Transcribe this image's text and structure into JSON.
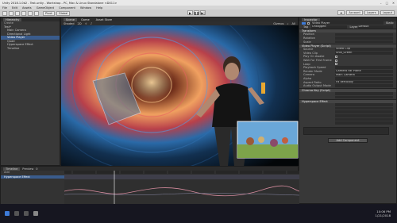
{
  "window": {
    "title": "Unity 2018.1.0b2 - Test.unity - Workshop - PC, Mac & Linux Standalone <DX11>"
  },
  "menu": [
    "File",
    "Edit",
    "Assets",
    "GameObject",
    "Component",
    "Window",
    "Help"
  ],
  "toolbar": {
    "pivot": "Pivot",
    "global": "Global",
    "account": "Account",
    "layers": "Layers",
    "layout": "Layout"
  },
  "hierarchy": {
    "tab": "Hierarchy",
    "create": "Create",
    "items": [
      "Test*",
      "Main Camera",
      "Directional Light",
      "Video Player",
      "Quad",
      "Hyperspace Effect",
      "Timeline"
    ]
  },
  "scene": {
    "tabs": [
      "Scene",
      "Game",
      "Asset Store"
    ],
    "shaded": "Shaded",
    "gizmos": "Gizmos",
    "all": "All"
  },
  "inspector": {
    "tab": "Inspector",
    "object_name": "Video Player",
    "static": "Static",
    "tag_label": "Tag",
    "tag": "Untagged",
    "layer_label": "Layer",
    "layer": "Default",
    "transform": "Transform",
    "position": "Position",
    "rotation": "Rotation",
    "scale": "Scale",
    "video_player": "Video Player (Script)",
    "source": "Source",
    "source_value": "Video Clip",
    "clip": "Video Clip",
    "clip_value": "Shia_Green",
    "play_on_awake": "Play On Awake",
    "wait_first": "Wait For First Frame",
    "loop": "Loop",
    "playback_speed": "Playback Speed",
    "render_mode": "Render Mode",
    "render_value": "Camera Far Plane",
    "camera": "Camera",
    "camera_value": "Main Camera",
    "alpha": "Alpha",
    "aspect": "Aspect Ratio",
    "aspect_value": "Fit Vertically",
    "audio_mode": "Audio Output Mode",
    "chroma": "Chroma Key (Script)",
    "hyperspace": "Hyperspace Effect",
    "add_component": "Add Component"
  },
  "timeline": {
    "tab": "Timeline",
    "preview": "Preview",
    "frame": "0",
    "track": "Hyperspace Effect",
    "add": "Add"
  },
  "clock": {
    "time": "10:06 PM",
    "date": "1/21/2018"
  },
  "colors": {
    "accent": "#3d7bd9",
    "curve": "#d38a9c",
    "selection": "#3a5c8c"
  }
}
